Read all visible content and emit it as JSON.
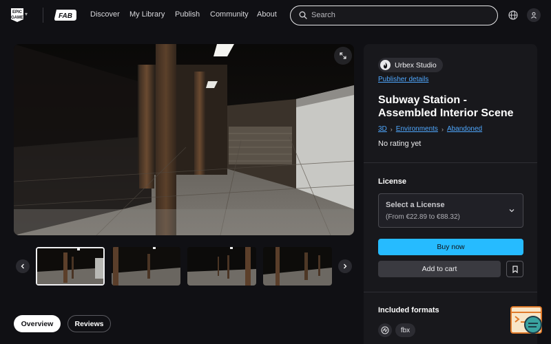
{
  "nav": {
    "epic_logo_text": "EPIC GAMES",
    "fab_logo_text": "FAB",
    "links": [
      "Discover",
      "My Library",
      "Publish",
      "Community",
      "About"
    ],
    "search_placeholder": "Search"
  },
  "gallery": {
    "thumbnail_count": 4,
    "active_thumbnail": 0
  },
  "tabs": {
    "overview": "Overview",
    "reviews": "Reviews"
  },
  "product": {
    "publisher": "Urbex Studio",
    "publisher_details": "Publisher details",
    "title": "Subway Station - Assembled Interior Scene",
    "breadcrumbs": [
      "3D",
      "Environments",
      "Abandoned"
    ],
    "rating": "No rating yet"
  },
  "license": {
    "label": "License",
    "select_title": "Select a License",
    "select_range": "(From €22.89 to €88.32)",
    "buy_label": "Buy now",
    "cart_label": "Add to cart"
  },
  "formats": {
    "label": "Included formats",
    "items": [
      "fbx"
    ]
  },
  "colors": {
    "accent": "#26bbff",
    "link": "#4fa8ff",
    "background": "#101014",
    "panel": "#18181c"
  }
}
